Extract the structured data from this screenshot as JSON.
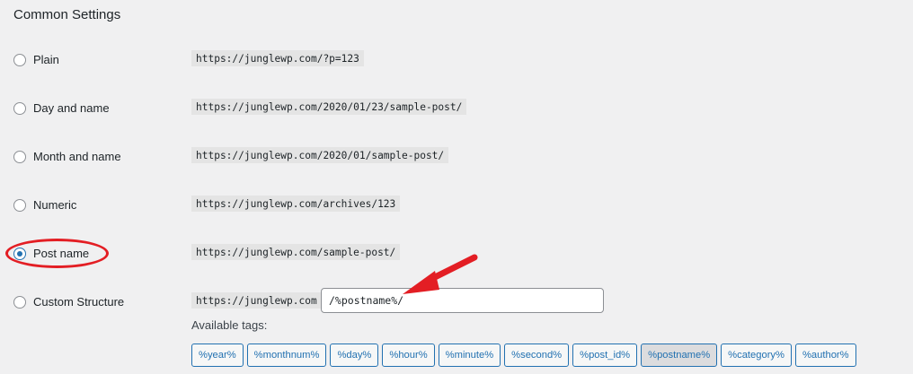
{
  "section": {
    "title": "Common Settings"
  },
  "options": [
    {
      "label": "Plain",
      "url": "https://junglewp.com/?p=123",
      "checked": false
    },
    {
      "label": "Day and name",
      "url": "https://junglewp.com/2020/01/23/sample-post/",
      "checked": false
    },
    {
      "label": "Month and name",
      "url": "https://junglewp.com/2020/01/sample-post/",
      "checked": false
    },
    {
      "label": "Numeric",
      "url": "https://junglewp.com/archives/123",
      "checked": false
    },
    {
      "label": "Post name",
      "url": "https://junglewp.com/sample-post/",
      "checked": true
    },
    {
      "label": "Custom Structure",
      "url": "https://junglewp.com",
      "checked": false
    }
  ],
  "custom_structure": {
    "value": "/%postname%/"
  },
  "available_tags": {
    "label": "Available tags:",
    "tags": [
      "%year%",
      "%monthnum%",
      "%day%",
      "%hour%",
      "%minute%",
      "%second%",
      "%post_id%",
      "%postname%",
      "%category%",
      "%author%"
    ],
    "active": "%postname%"
  },
  "colors": {
    "accent": "#2271b1",
    "annotation": "#e31e24"
  }
}
